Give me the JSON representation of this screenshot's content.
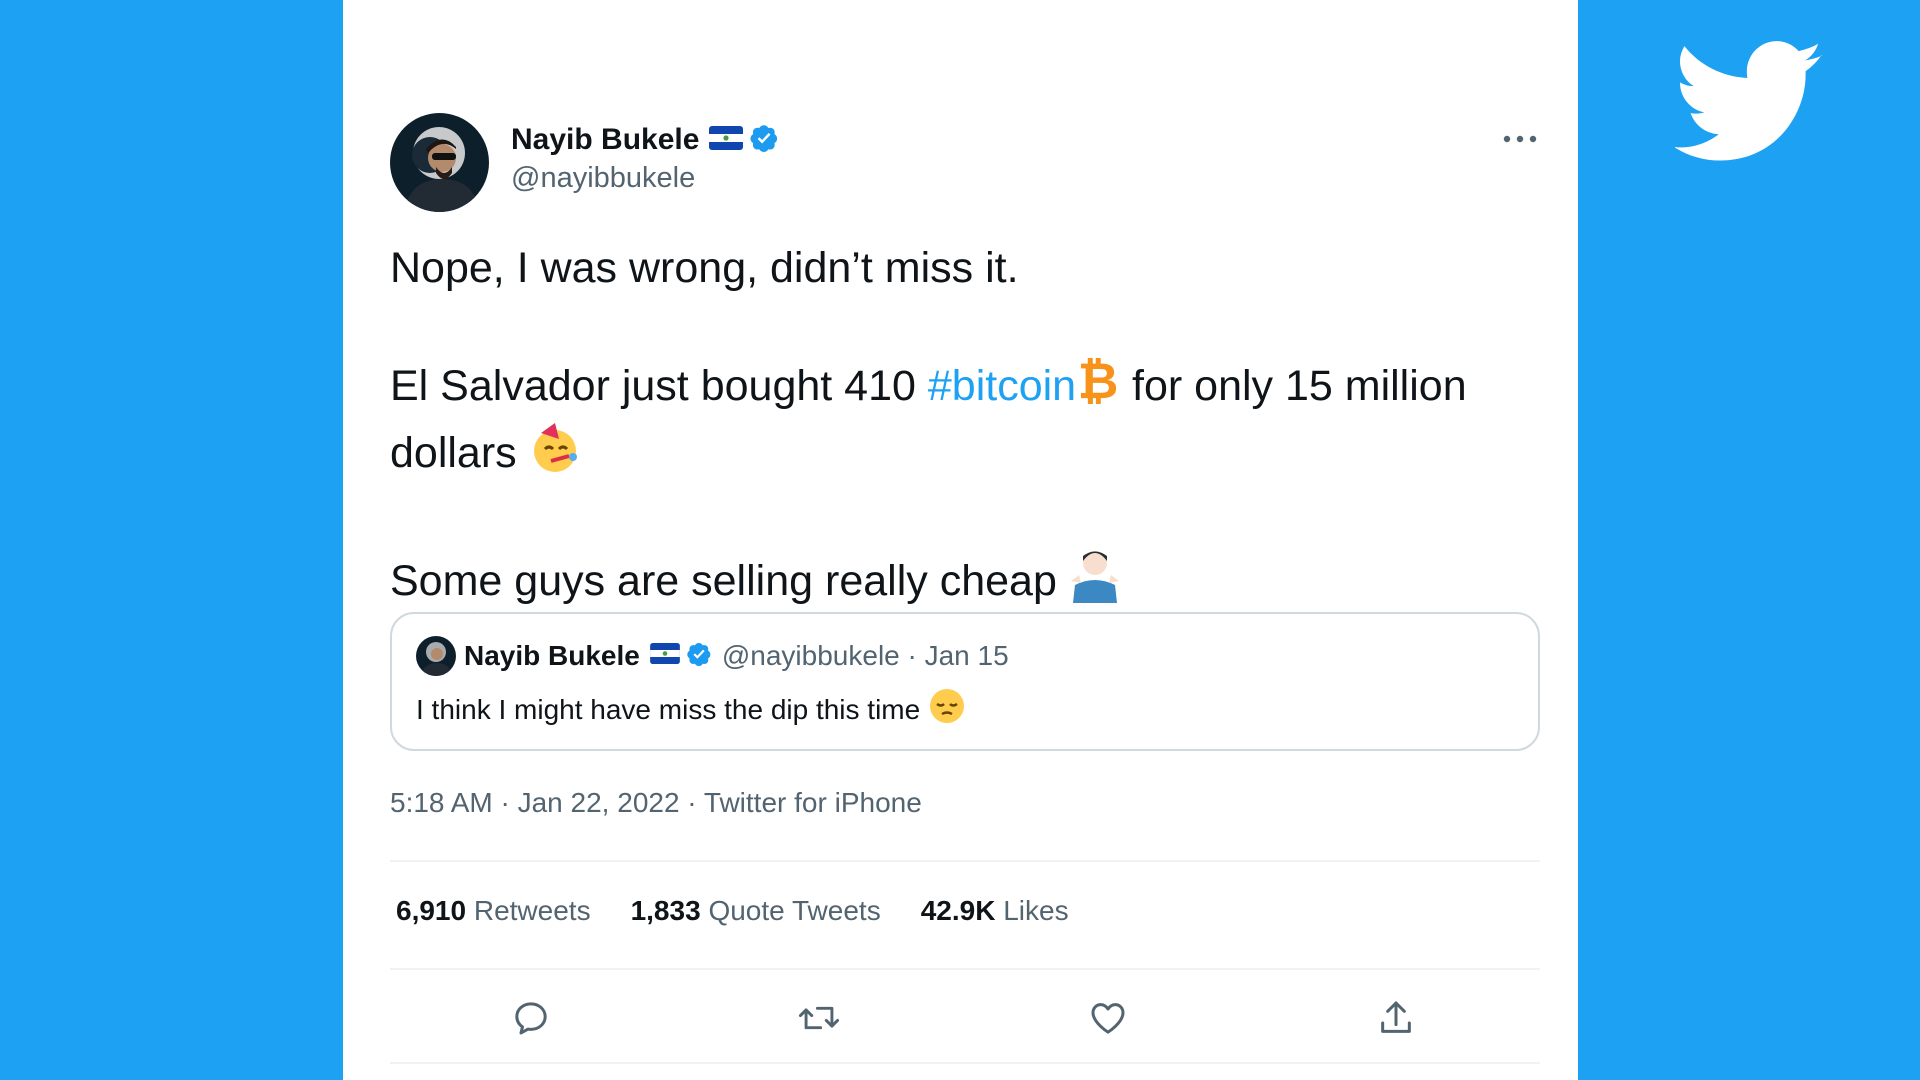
{
  "colors": {
    "background": "#1DA1F2",
    "hashtag": "#1DA1F2",
    "verified": "#1D9BF0",
    "bitcoin": "#F7931A",
    "text": "#0f1419",
    "secondary": "#536471"
  },
  "tweet": {
    "author": {
      "name": "Nayib Bukele",
      "handle": "@nayibbukele",
      "flag_icon": "el-salvador-flag-icon",
      "verified_icon": "verified-badge-icon"
    },
    "body": {
      "line1": "Nope, I was wrong, didn’t miss it.",
      "line2_before": "El Salvador just bought 410 ",
      "hashtag": "#bitcoin",
      "line2_after": " for only 15 million dollars",
      "line3": "Some guys are selling really cheap"
    },
    "quote": {
      "name": "Nayib Bukele",
      "handle_date": "@nayibbukele · Jan 15",
      "text": "I think I might have miss the dip this time"
    },
    "meta": "5:18 AM · Jan 22, 2022 · Twitter for iPhone",
    "stats": [
      {
        "count": "6,910",
        "label": "Retweets"
      },
      {
        "count": "1,833",
        "label": "Quote Tweets"
      },
      {
        "count": "42.9K",
        "label": "Likes"
      }
    ],
    "actions": [
      "reply-icon",
      "retweet-icon",
      "like-icon",
      "share-icon"
    ]
  }
}
